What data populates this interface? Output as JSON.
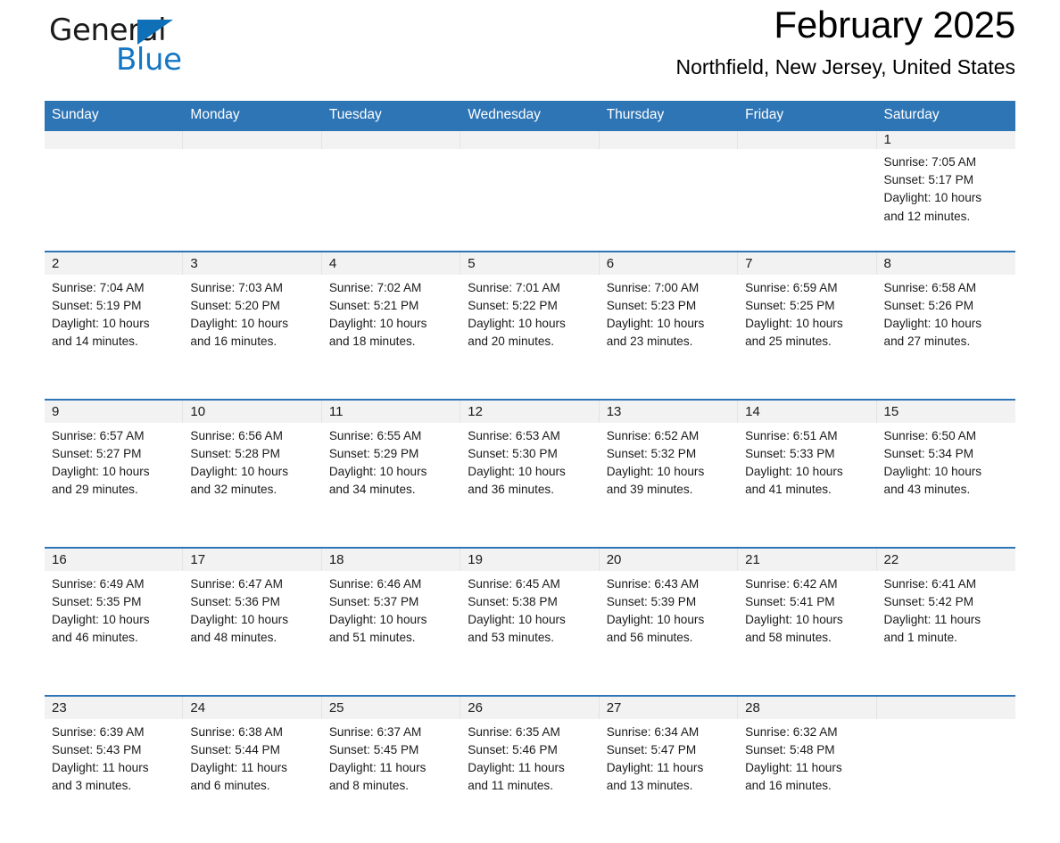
{
  "logo": {
    "word_one": "General",
    "word_two": "Blue",
    "triangle_color": "#0f70b7",
    "blue_text_color": "#1477c4"
  },
  "header": {
    "title": "February 2025",
    "subtitle": "Northfield, New Jersey, United States"
  },
  "theme": {
    "header_blue": "#2e75b6",
    "day_band_gray": "#f2f2f2",
    "text_black": "#1a1a1a"
  },
  "weekday_headers": [
    "Sunday",
    "Monday",
    "Tuesday",
    "Wednesday",
    "Thursday",
    "Friday",
    "Saturday"
  ],
  "labels": {
    "sunrise_prefix": "Sunrise:",
    "sunset_prefix": "Sunset:",
    "daylight_prefix": "Daylight:"
  },
  "weeks": [
    {
      "days": [
        {
          "empty": true
        },
        {
          "empty": true
        },
        {
          "empty": true
        },
        {
          "empty": true
        },
        {
          "empty": true
        },
        {
          "empty": true
        },
        {
          "empty": false,
          "num": "1",
          "sunrise": "Sunrise: 7:05 AM",
          "sunset": "Sunset: 5:17 PM",
          "daylight_line1": "Daylight: 10 hours",
          "daylight_line2": "and 12 minutes."
        }
      ]
    },
    {
      "days": [
        {
          "empty": false,
          "num": "2",
          "sunrise": "Sunrise: 7:04 AM",
          "sunset": "Sunset: 5:19 PM",
          "daylight_line1": "Daylight: 10 hours",
          "daylight_line2": "and 14 minutes."
        },
        {
          "empty": false,
          "num": "3",
          "sunrise": "Sunrise: 7:03 AM",
          "sunset": "Sunset: 5:20 PM",
          "daylight_line1": "Daylight: 10 hours",
          "daylight_line2": "and 16 minutes."
        },
        {
          "empty": false,
          "num": "4",
          "sunrise": "Sunrise: 7:02 AM",
          "sunset": "Sunset: 5:21 PM",
          "daylight_line1": "Daylight: 10 hours",
          "daylight_line2": "and 18 minutes."
        },
        {
          "empty": false,
          "num": "5",
          "sunrise": "Sunrise: 7:01 AM",
          "sunset": "Sunset: 5:22 PM",
          "daylight_line1": "Daylight: 10 hours",
          "daylight_line2": "and 20 minutes."
        },
        {
          "empty": false,
          "num": "6",
          "sunrise": "Sunrise: 7:00 AM",
          "sunset": "Sunset: 5:23 PM",
          "daylight_line1": "Daylight: 10 hours",
          "daylight_line2": "and 23 minutes."
        },
        {
          "empty": false,
          "num": "7",
          "sunrise": "Sunrise: 6:59 AM",
          "sunset": "Sunset: 5:25 PM",
          "daylight_line1": "Daylight: 10 hours",
          "daylight_line2": "and 25 minutes."
        },
        {
          "empty": false,
          "num": "8",
          "sunrise": "Sunrise: 6:58 AM",
          "sunset": "Sunset: 5:26 PM",
          "daylight_line1": "Daylight: 10 hours",
          "daylight_line2": "and 27 minutes."
        }
      ]
    },
    {
      "days": [
        {
          "empty": false,
          "num": "9",
          "sunrise": "Sunrise: 6:57 AM",
          "sunset": "Sunset: 5:27 PM",
          "daylight_line1": "Daylight: 10 hours",
          "daylight_line2": "and 29 minutes."
        },
        {
          "empty": false,
          "num": "10",
          "sunrise": "Sunrise: 6:56 AM",
          "sunset": "Sunset: 5:28 PM",
          "daylight_line1": "Daylight: 10 hours",
          "daylight_line2": "and 32 minutes."
        },
        {
          "empty": false,
          "num": "11",
          "sunrise": "Sunrise: 6:55 AM",
          "sunset": "Sunset: 5:29 PM",
          "daylight_line1": "Daylight: 10 hours",
          "daylight_line2": "and 34 minutes."
        },
        {
          "empty": false,
          "num": "12",
          "sunrise": "Sunrise: 6:53 AM",
          "sunset": "Sunset: 5:30 PM",
          "daylight_line1": "Daylight: 10 hours",
          "daylight_line2": "and 36 minutes."
        },
        {
          "empty": false,
          "num": "13",
          "sunrise": "Sunrise: 6:52 AM",
          "sunset": "Sunset: 5:32 PM",
          "daylight_line1": "Daylight: 10 hours",
          "daylight_line2": "and 39 minutes."
        },
        {
          "empty": false,
          "num": "14",
          "sunrise": "Sunrise: 6:51 AM",
          "sunset": "Sunset: 5:33 PM",
          "daylight_line1": "Daylight: 10 hours",
          "daylight_line2": "and 41 minutes."
        },
        {
          "empty": false,
          "num": "15",
          "sunrise": "Sunrise: 6:50 AM",
          "sunset": "Sunset: 5:34 PM",
          "daylight_line1": "Daylight: 10 hours",
          "daylight_line2": "and 43 minutes."
        }
      ]
    },
    {
      "days": [
        {
          "empty": false,
          "num": "16",
          "sunrise": "Sunrise: 6:49 AM",
          "sunset": "Sunset: 5:35 PM",
          "daylight_line1": "Daylight: 10 hours",
          "daylight_line2": "and 46 minutes."
        },
        {
          "empty": false,
          "num": "17",
          "sunrise": "Sunrise: 6:47 AM",
          "sunset": "Sunset: 5:36 PM",
          "daylight_line1": "Daylight: 10 hours",
          "daylight_line2": "and 48 minutes."
        },
        {
          "empty": false,
          "num": "18",
          "sunrise": "Sunrise: 6:46 AM",
          "sunset": "Sunset: 5:37 PM",
          "daylight_line1": "Daylight: 10 hours",
          "daylight_line2": "and 51 minutes."
        },
        {
          "empty": false,
          "num": "19",
          "sunrise": "Sunrise: 6:45 AM",
          "sunset": "Sunset: 5:38 PM",
          "daylight_line1": "Daylight: 10 hours",
          "daylight_line2": "and 53 minutes."
        },
        {
          "empty": false,
          "num": "20",
          "sunrise": "Sunrise: 6:43 AM",
          "sunset": "Sunset: 5:39 PM",
          "daylight_line1": "Daylight: 10 hours",
          "daylight_line2": "and 56 minutes."
        },
        {
          "empty": false,
          "num": "21",
          "sunrise": "Sunrise: 6:42 AM",
          "sunset": "Sunset: 5:41 PM",
          "daylight_line1": "Daylight: 10 hours",
          "daylight_line2": "and 58 minutes."
        },
        {
          "empty": false,
          "num": "22",
          "sunrise": "Sunrise: 6:41 AM",
          "sunset": "Sunset: 5:42 PM",
          "daylight_line1": "Daylight: 11 hours",
          "daylight_line2": "and 1 minute."
        }
      ]
    },
    {
      "days": [
        {
          "empty": false,
          "num": "23",
          "sunrise": "Sunrise: 6:39 AM",
          "sunset": "Sunset: 5:43 PM",
          "daylight_line1": "Daylight: 11 hours",
          "daylight_line2": "and 3 minutes."
        },
        {
          "empty": false,
          "num": "24",
          "sunrise": "Sunrise: 6:38 AM",
          "sunset": "Sunset: 5:44 PM",
          "daylight_line1": "Daylight: 11 hours",
          "daylight_line2": "and 6 minutes."
        },
        {
          "empty": false,
          "num": "25",
          "sunrise": "Sunrise: 6:37 AM",
          "sunset": "Sunset: 5:45 PM",
          "daylight_line1": "Daylight: 11 hours",
          "daylight_line2": "and 8 minutes."
        },
        {
          "empty": false,
          "num": "26",
          "sunrise": "Sunrise: 6:35 AM",
          "sunset": "Sunset: 5:46 PM",
          "daylight_line1": "Daylight: 11 hours",
          "daylight_line2": "and 11 minutes."
        },
        {
          "empty": false,
          "num": "27",
          "sunrise": "Sunrise: 6:34 AM",
          "sunset": "Sunset: 5:47 PM",
          "daylight_line1": "Daylight: 11 hours",
          "daylight_line2": "and 13 minutes."
        },
        {
          "empty": false,
          "num": "28",
          "sunrise": "Sunrise: 6:32 AM",
          "sunset": "Sunset: 5:48 PM",
          "daylight_line1": "Daylight: 11 hours",
          "daylight_line2": "and 16 minutes."
        },
        {
          "empty": true
        }
      ]
    }
  ]
}
